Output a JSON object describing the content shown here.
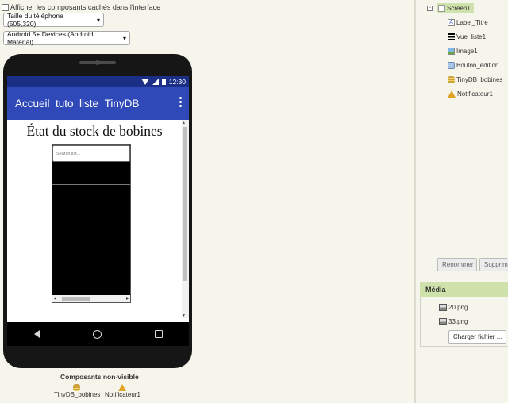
{
  "viewer": {
    "hidden_components_checkbox": "Afficher les composants cachés dans l'interface",
    "phone_size_select": "Taille du téléphone (505,320)",
    "theme_select": "Android 5+ Devices (Android Material)"
  },
  "phone": {
    "status_time": "12:30",
    "app_title": "Accueil_tuto_liste_TinyDB",
    "heading": "État du stock de bobines",
    "search_placeholder": "Search list..."
  },
  "non_visible": {
    "title": "Composants non-visible",
    "items": [
      "TinyDB_bobines",
      "Notificateur1"
    ]
  },
  "components": {
    "root": "Screen1",
    "children": [
      "Label_Titre",
      "Vue_liste1",
      "Image1",
      "Bouton_edition",
      "TinyDB_bobines",
      "Notificateur1"
    ],
    "rename_button": "Renommer",
    "delete_button": "Supprimer"
  },
  "media": {
    "header": "Média",
    "files": [
      "20.png",
      "33.png"
    ],
    "upload_button": "Charger fichier ..."
  },
  "colors": {
    "app_bar": "#2f49b8",
    "status_bar": "#1b2f86",
    "selection": "#cfe2ab",
    "background": "#f6f5ec"
  }
}
